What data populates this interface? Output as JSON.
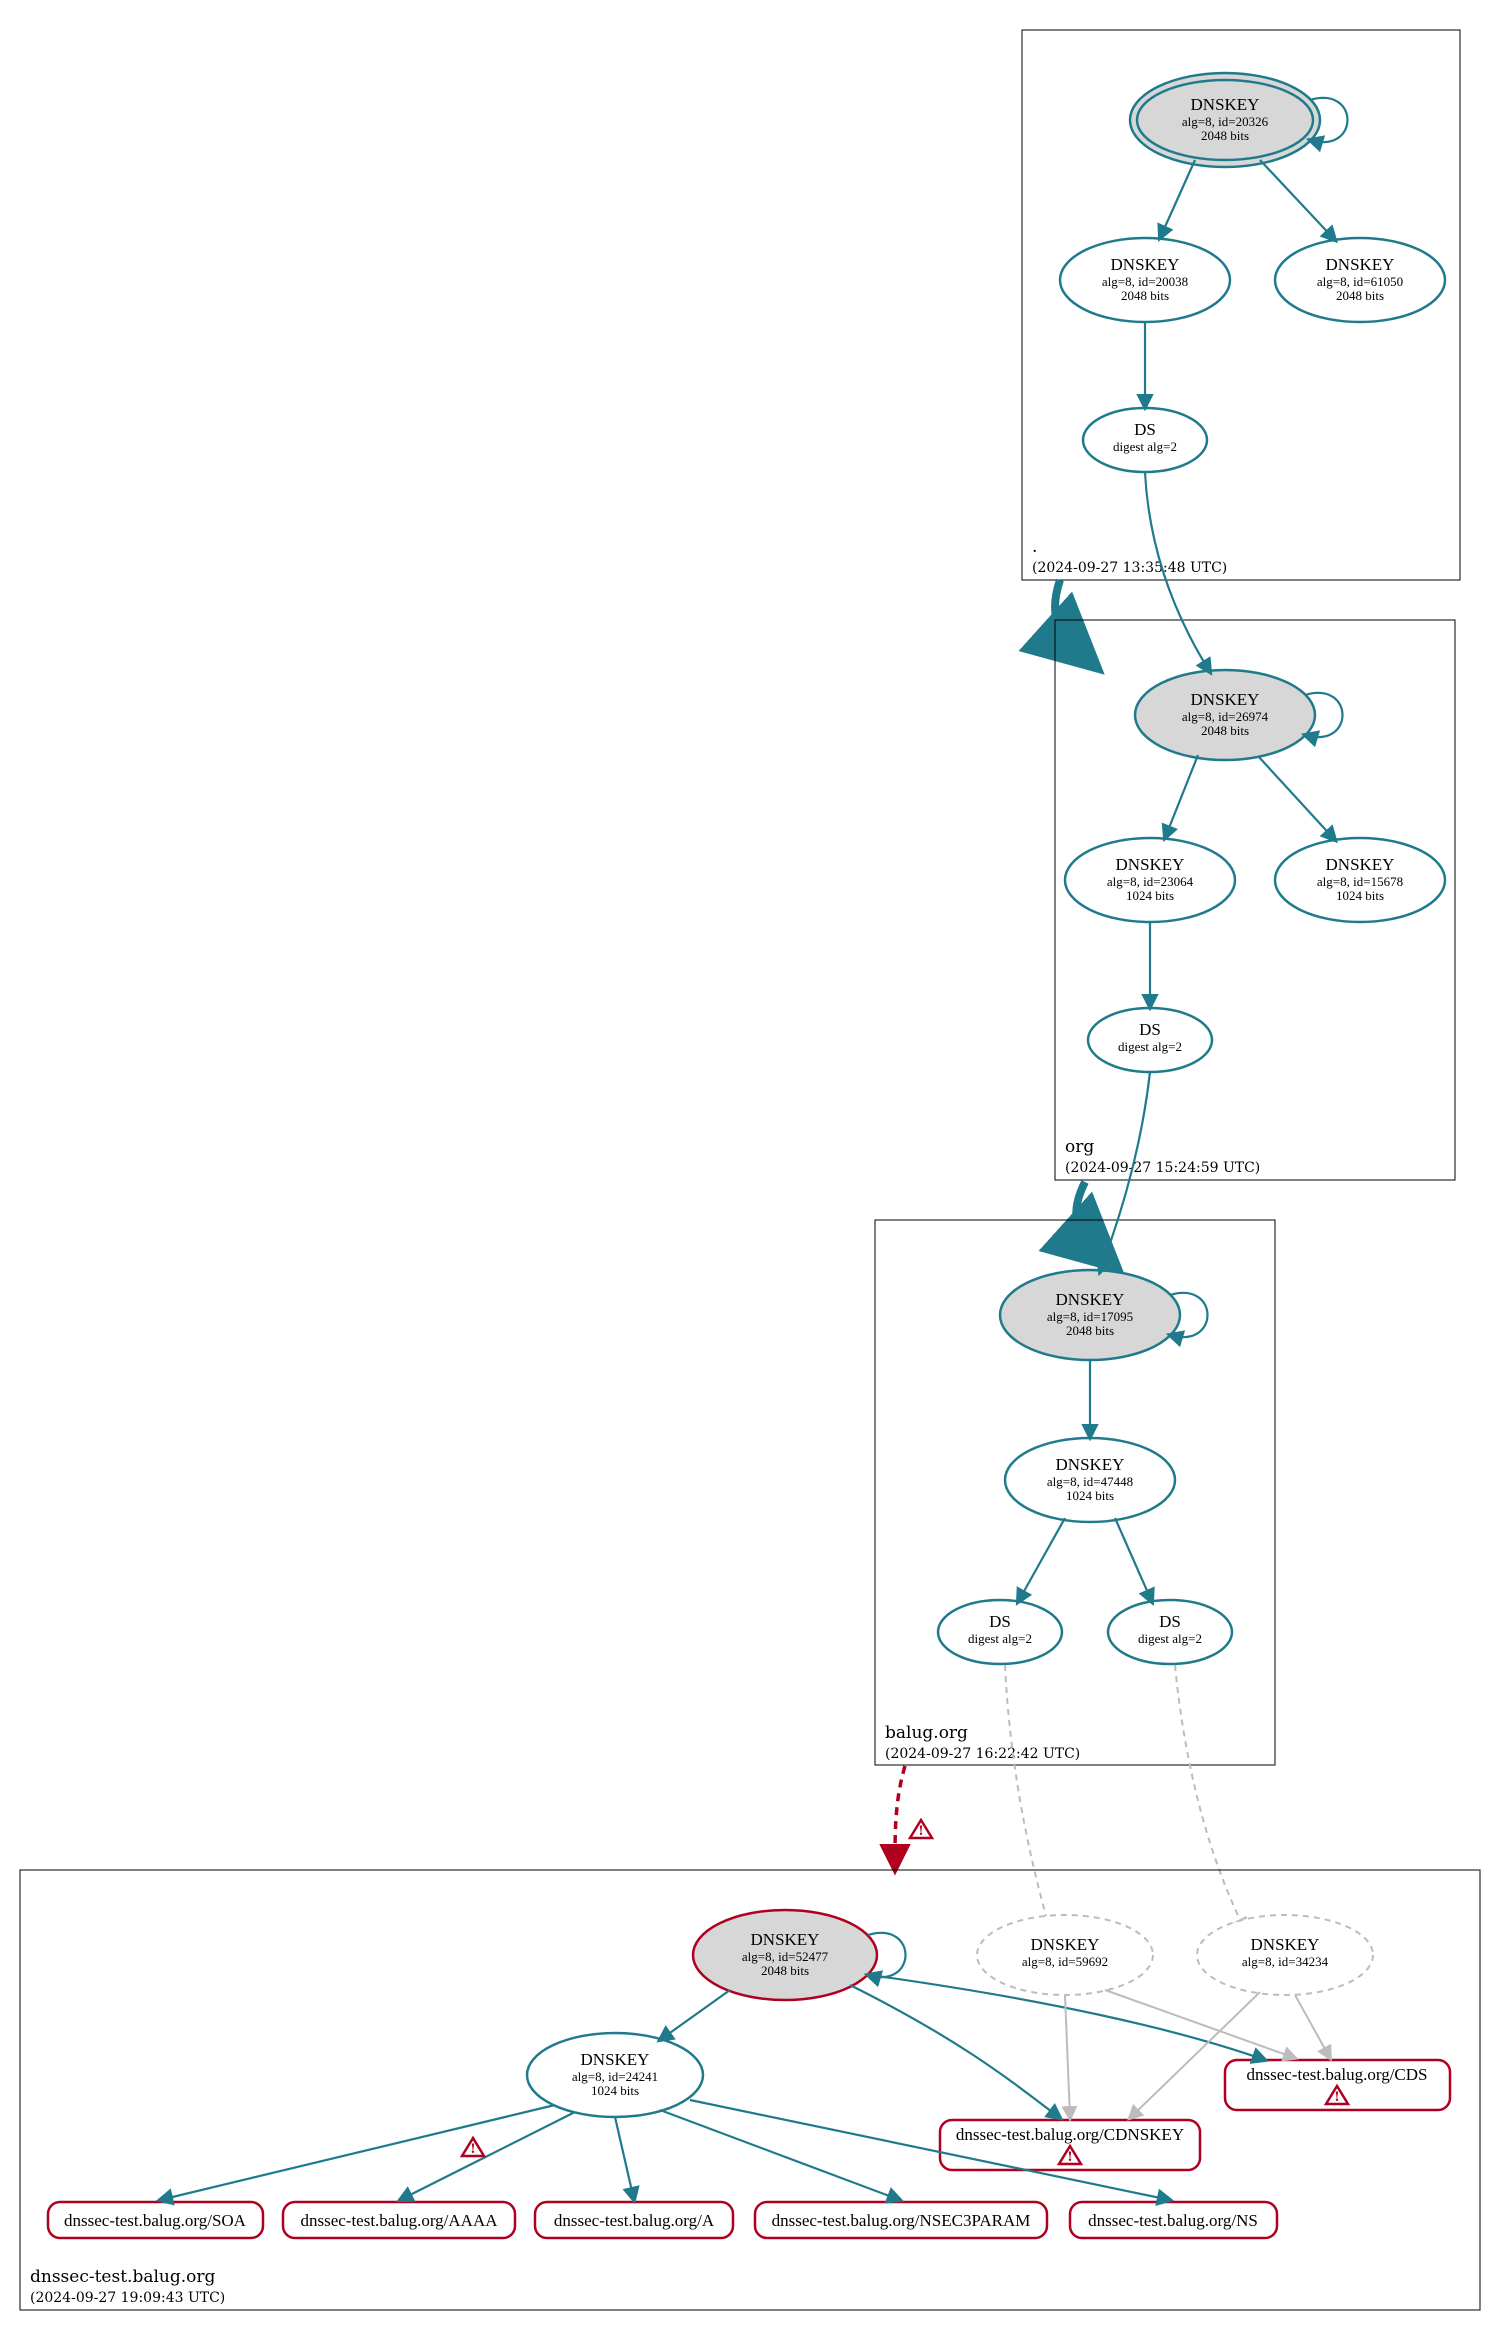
{
  "colors": {
    "teal": "#1f7a8c",
    "red": "#b00020",
    "grey_fill": "#d7d7d7",
    "grey_stroke": "#bcbcbc"
  },
  "clusters": {
    "root": {
      "name": ".",
      "timestamp": "(2024-09-27 13:35:48 UTC)",
      "nodes": {
        "ksk": {
          "title": "DNSKEY",
          "l1": "alg=8, id=20326",
          "l2": "2048 bits"
        },
        "zsk1": {
          "title": "DNSKEY",
          "l1": "alg=8, id=20038",
          "l2": "2048 bits"
        },
        "zsk2": {
          "title": "DNSKEY",
          "l1": "alg=8, id=61050",
          "l2": "2048 bits"
        },
        "ds": {
          "title": "DS",
          "l1": "digest alg=2"
        }
      }
    },
    "org": {
      "name": "org",
      "timestamp": "(2024-09-27 15:24:59 UTC)",
      "nodes": {
        "ksk": {
          "title": "DNSKEY",
          "l1": "alg=8, id=26974",
          "l2": "2048 bits"
        },
        "zsk1": {
          "title": "DNSKEY",
          "l1": "alg=8, id=23064",
          "l2": "1024 bits"
        },
        "zsk2": {
          "title": "DNSKEY",
          "l1": "alg=8, id=15678",
          "l2": "1024 bits"
        },
        "ds": {
          "title": "DS",
          "l1": "digest alg=2"
        }
      }
    },
    "balug": {
      "name": "balug.org",
      "timestamp": "(2024-09-27 16:22:42 UTC)",
      "nodes": {
        "ksk": {
          "title": "DNSKEY",
          "l1": "alg=8, id=17095",
          "l2": "2048 bits"
        },
        "zsk": {
          "title": "DNSKEY",
          "l1": "alg=8, id=47448",
          "l2": "1024 bits"
        },
        "ds1": {
          "title": "DS",
          "l1": "digest alg=2"
        },
        "ds2": {
          "title": "DS",
          "l1": "digest alg=2"
        }
      }
    },
    "dnssec_test": {
      "name": "dnssec-test.balug.org",
      "timestamp": "(2024-09-27 19:09:43 UTC)",
      "nodes": {
        "ksk": {
          "title": "DNSKEY",
          "l1": "alg=8, id=52477",
          "l2": "2048 bits"
        },
        "zsk": {
          "title": "DNSKEY",
          "l1": "alg=8, id=24241",
          "l2": "1024 bits"
        },
        "ghost1": {
          "title": "DNSKEY",
          "l1": "alg=8, id=59692"
        },
        "ghost2": {
          "title": "DNSKEY",
          "l1": "alg=8, id=34234"
        }
      },
      "rrsets": {
        "soa": "dnssec-test.balug.org/SOA",
        "aaaa": "dnssec-test.balug.org/AAAA",
        "a": "dnssec-test.balug.org/A",
        "nsec3param": "dnssec-test.balug.org/NSEC3PARAM",
        "ns": "dnssec-test.balug.org/NS",
        "cdnskey": "dnssec-test.balug.org/CDNSKEY",
        "cds": "dnssec-test.balug.org/CDS"
      }
    }
  }
}
